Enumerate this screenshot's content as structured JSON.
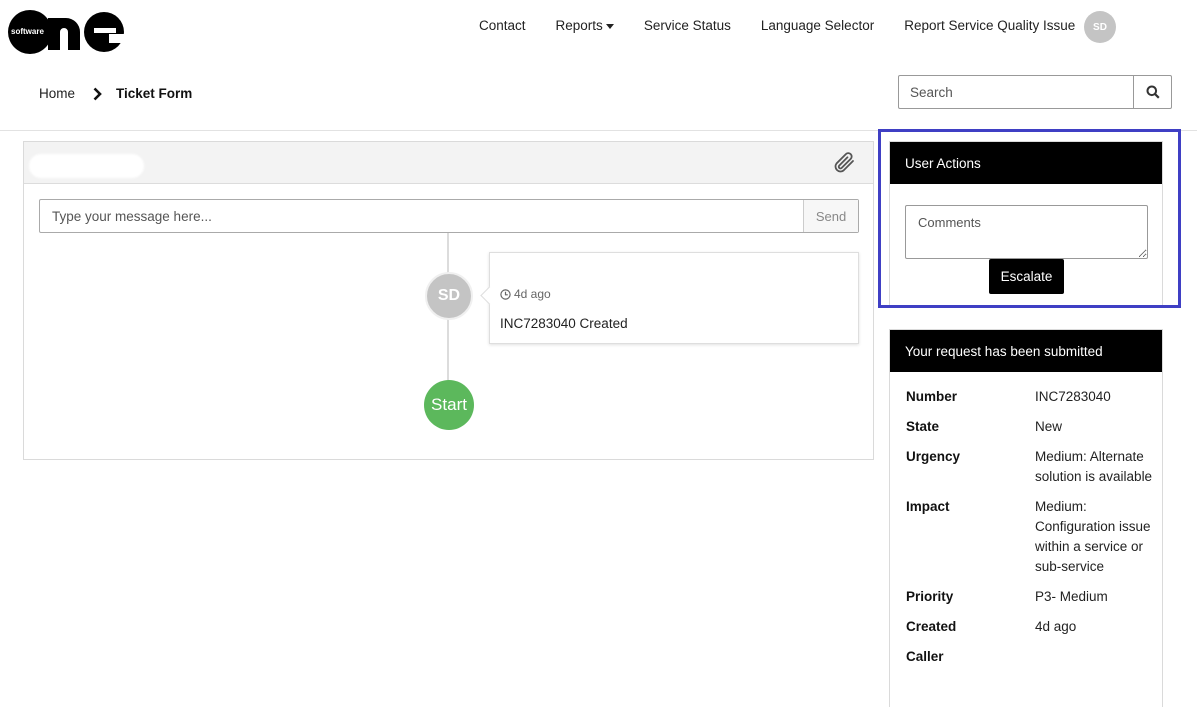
{
  "brand": {
    "logo_small_text": "software",
    "logo_big_text": "one"
  },
  "nav": {
    "items": [
      "Contact",
      "Reports",
      "Service Status",
      "Language Selector",
      "Report Service Quality Issue"
    ],
    "user_initials": "SD"
  },
  "breadcrumb": {
    "home": "Home",
    "current": "Ticket Form"
  },
  "search": {
    "placeholder": "Search"
  },
  "ticket": {
    "message_placeholder": "Type your message here...",
    "send_label": "Send",
    "timeline": {
      "avatar_initials": "SD",
      "time": "4d ago",
      "text": "INC7283040 Created",
      "start_label": "Start"
    }
  },
  "user_actions": {
    "title": "User Actions",
    "comments_placeholder": "Comments",
    "escalate_label": "Escalate"
  },
  "submitted": {
    "title": "Your request has been submitted",
    "rows": [
      {
        "label": "Number",
        "value": "INC7283040"
      },
      {
        "label": "State",
        "value": "New"
      },
      {
        "label": "Urgency",
        "value": "Medium: Alternate solution is available"
      },
      {
        "label": "Impact",
        "value": "Medium: Configuration issue within a service or sub-service"
      },
      {
        "label": "Priority",
        "value": "P3- Medium"
      },
      {
        "label": "Created",
        "value": "4d ago"
      },
      {
        "label": "Caller",
        "value": ""
      }
    ]
  },
  "colors": {
    "highlight": "#3f3fc4",
    "start_green": "#5cb85c",
    "avatar_gray": "#c4c4c4"
  }
}
